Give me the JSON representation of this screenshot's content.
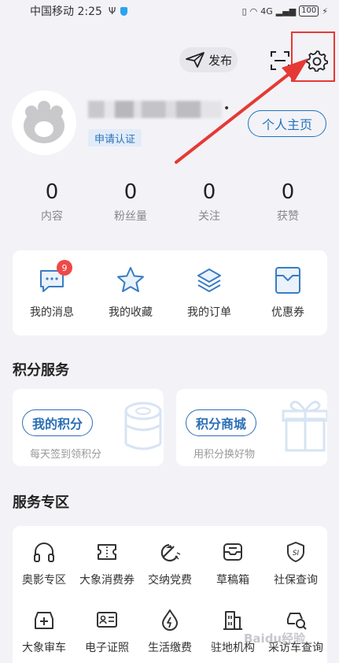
{
  "status_bar": {
    "carrier_time": "中国移动 2:25",
    "usb": "Ψ",
    "signal": "4G",
    "battery": "100"
  },
  "header": {
    "post_label": "发布",
    "post_icon": "send-icon",
    "scan_icon": "scan-icon",
    "settings_icon": "gear-icon"
  },
  "profile": {
    "verify_label": "申请认证",
    "home_button": "个人主页",
    "username_suffix": "•"
  },
  "stats": [
    {
      "value": "0",
      "label": "内容"
    },
    {
      "value": "0",
      "label": "粉丝量"
    },
    {
      "value": "0",
      "label": "关注"
    },
    {
      "value": "0",
      "label": "获赞"
    }
  ],
  "quick_actions": [
    {
      "label": "我的消息",
      "icon": "message-icon",
      "badge": "9"
    },
    {
      "label": "我的收藏",
      "icon": "star-icon"
    },
    {
      "label": "我的订单",
      "icon": "layers-icon"
    },
    {
      "label": "优惠券",
      "icon": "coupon-icon"
    }
  ],
  "points_section": {
    "title": "积分服务",
    "cards": [
      {
        "button": "我的积分",
        "subtitle": "每天签到领积分"
      },
      {
        "button": "积分商城",
        "subtitle": "用积分换好物"
      }
    ]
  },
  "services_section": {
    "title": "服务专区",
    "row1": [
      {
        "label": "奥影专区",
        "icon": "headphones-icon"
      },
      {
        "label": "大象消费券",
        "icon": "ticket-icon"
      },
      {
        "label": "交纳党费",
        "icon": "party-emblem-icon"
      },
      {
        "label": "草稿箱",
        "icon": "inbox-icon"
      },
      {
        "label": "社保查询",
        "icon": "shield-si-icon"
      }
    ],
    "row2": [
      {
        "label": "大象审车",
        "icon": "car-inspect-icon"
      },
      {
        "label": "电子证照",
        "icon": "id-card-icon"
      },
      {
        "label": "生活缴费",
        "icon": "utility-drop-icon"
      },
      {
        "label": "驻地机构",
        "icon": "building-icon"
      },
      {
        "label": "采访车查询",
        "icon": "car-search-icon"
      }
    ]
  },
  "watermark": "Baidu经验",
  "colors": {
    "accent": "#1f74bf",
    "highlight": "#e53935",
    "background": "#f3f2f7",
    "badge": "#f04848"
  }
}
